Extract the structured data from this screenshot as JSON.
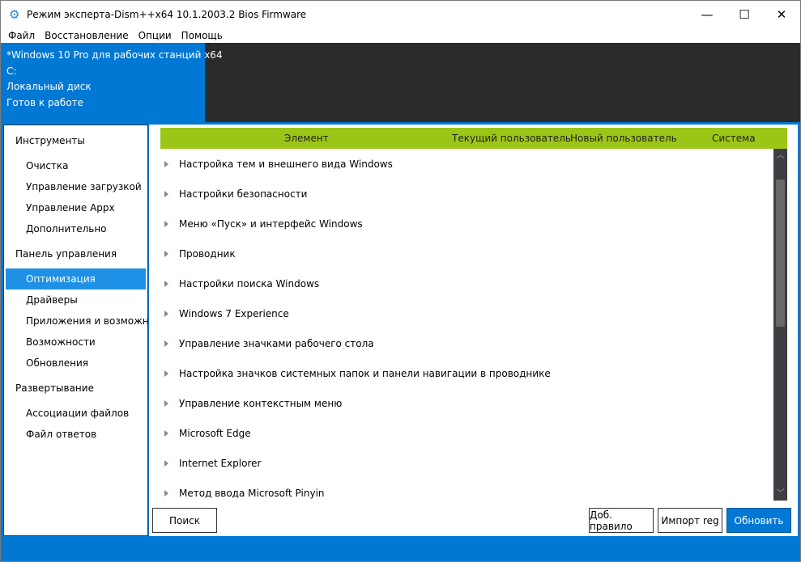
{
  "window": {
    "title": "Режим эксперта-Dism++x64 10.1.2003.2 Bios Firmware",
    "controls": [
      "minimize",
      "maximize",
      "close"
    ]
  },
  "menu": [
    "Файл",
    "Восстановление",
    "Опции",
    "Помощь"
  ],
  "info": {
    "os": "*Windows 10 Pro для рабочих станций x64",
    "drive": "C:",
    "label": "Локальный диск",
    "status": "Готов к работе"
  },
  "sidebar": [
    {
      "group": "Инструменты",
      "items": [
        "Очистка",
        "Управление загрузкой",
        "Управление Appx",
        "Дополнительно"
      ]
    },
    {
      "group": "Панель управления",
      "items": [
        "Оптимизация",
        "Драйверы",
        "Приложения и возможности",
        "Возможности",
        "Обновления"
      ]
    },
    {
      "group": "Развертывание",
      "items": [
        "Ассоциации файлов",
        "Файл ответов"
      ]
    }
  ],
  "selected": "Оптимизация",
  "table": {
    "columns": [
      "Элемент",
      "Текущий пользователь",
      "Новый пользователь",
      "Система"
    ],
    "rows": [
      "Настройка тем и внешнего вида Windows",
      "Настройки безопасности",
      "Меню «Пуск» и интерфейс Windows",
      "Проводник",
      "Настройки поиска Windows",
      "Windows 7 Experience",
      "Управление значками рабочего стола",
      "Настройка значков системных папок и панели навигации в проводнике",
      "Управление контекстным меню",
      "Microsoft Edge",
      "Internet Explorer",
      "Метод ввода Microsoft Pinyin"
    ]
  },
  "buttons": {
    "search": "Поиск",
    "add_rule": "Доб. правило",
    "import_reg": "Импорт reg",
    "refresh": "Обновить"
  },
  "colors": {
    "accent": "#0078d4",
    "header_green": "#9cc617",
    "selected": "#1e90e6"
  }
}
